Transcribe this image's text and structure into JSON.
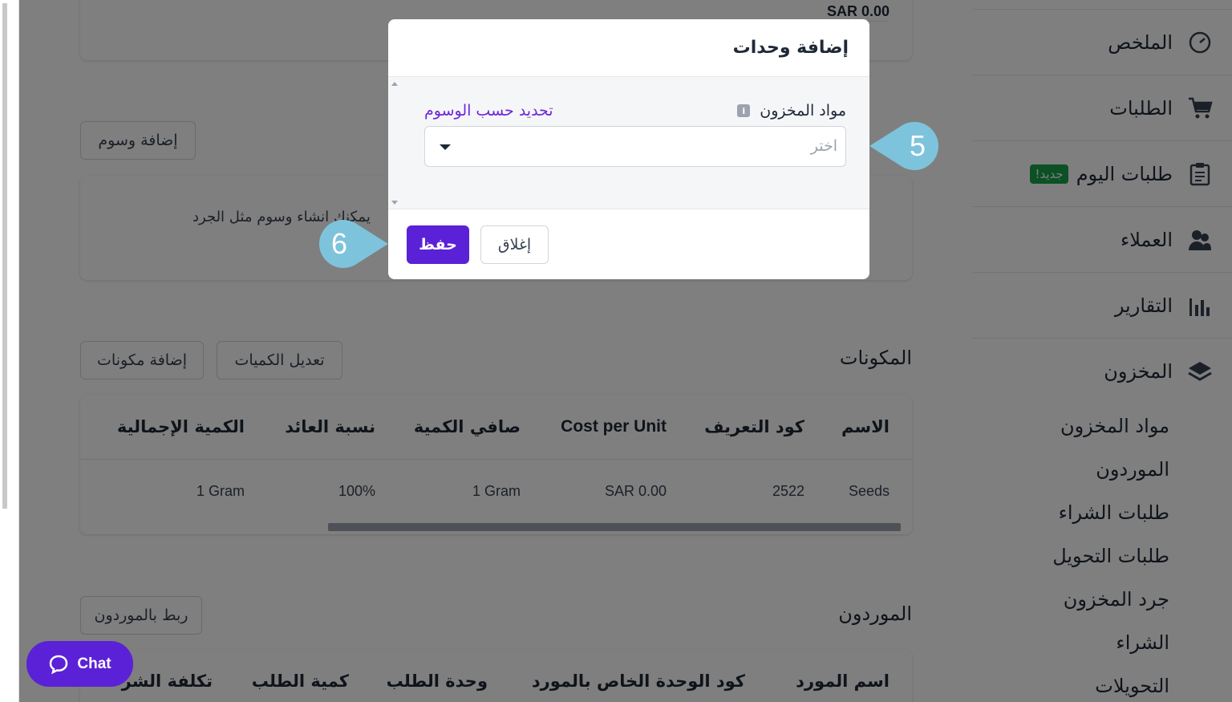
{
  "sidebar": {
    "items": [
      {
        "label": "الملخص",
        "icon": "dashboard-gauge-icon"
      },
      {
        "label": "الطلبات",
        "icon": "cart-icon"
      },
      {
        "label": "طلبات اليوم",
        "icon": "clipboard-icon",
        "badge": "جديد!"
      },
      {
        "label": "العملاء",
        "icon": "customers-icon"
      },
      {
        "label": "التقارير",
        "icon": "bar-chart-icon"
      },
      {
        "label": "المخزون",
        "icon": "layers-icon"
      }
    ],
    "inventory_sub": [
      "مواد المخزون",
      "الموردون",
      "طلبات الشراء",
      "طلبات التحويل",
      "جرد المخزون",
      "الشراء",
      "التحويلات"
    ]
  },
  "main": {
    "top_card_value": "SAR 0.00",
    "tags": {
      "add_button": "إضافة وسوم",
      "empty_text": "يمكنك انشاء وسوم مثل الجرد"
    },
    "ingredients": {
      "title": "المكونات",
      "edit_button": "تعديل الكميات",
      "add_button": "إضافة مكونات",
      "headers": [
        "الاسم",
        "كود التعريف",
        "Cost per Unit",
        "صافي الكمية",
        "نسبة العائد",
        "الكمية الإجمالية"
      ],
      "rows": [
        [
          "Seeds",
          "2522",
          "SAR 0.00",
          "1 Gram",
          "100%",
          "1 Gram"
        ]
      ]
    },
    "suppliers": {
      "title": "الموردون",
      "link_button": "ربط بالموردون",
      "headers": [
        "اسم المورد",
        "كود الوحدة الخاص بالمورد",
        "وحدة الطلب",
        "كمية الطلب",
        "تكلفة الشر"
      ]
    }
  },
  "modal": {
    "title": "إضافة وحدات",
    "field_label": "مواد المخزون",
    "tag_link": "تحديد حسب الوسوم",
    "select_placeholder": "اختر",
    "save_label": "حفظ",
    "close_label": "إغلاق"
  },
  "callouts": {
    "step5": "5",
    "step6": "6",
    "color": "#7ec3dc"
  },
  "chat": {
    "label": "Chat"
  },
  "colors": {
    "accent": "#5b21d6",
    "badge": "#16a34a",
    "link": "#6d28d9"
  }
}
